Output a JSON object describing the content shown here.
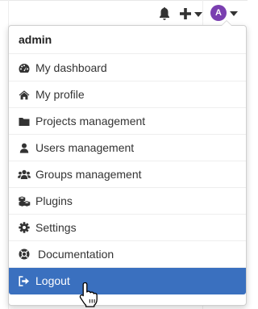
{
  "navbar": {
    "notifications_icon": "bell-icon",
    "new_icon": "plus-icon",
    "avatar_letter": "A",
    "avatar_color": "#7a3fb0"
  },
  "menu": {
    "header": "admin",
    "items": [
      {
        "label": "My dashboard",
        "icon": "dashboard-icon"
      },
      {
        "label": "My profile",
        "icon": "home-icon"
      },
      {
        "label": "Projects management",
        "icon": "folder-icon"
      },
      {
        "label": "Users management",
        "icon": "user-icon"
      },
      {
        "label": "Groups management",
        "icon": "users-icon"
      },
      {
        "label": "Plugins",
        "icon": "cubes-icon"
      },
      {
        "label": "Settings",
        "icon": "cog-icon"
      },
      {
        "label": "Documentation",
        "icon": "life-ring-icon"
      },
      {
        "label": "Logout",
        "icon": "sign-out-icon",
        "active": true
      }
    ],
    "active_color": "#3a70bf"
  }
}
